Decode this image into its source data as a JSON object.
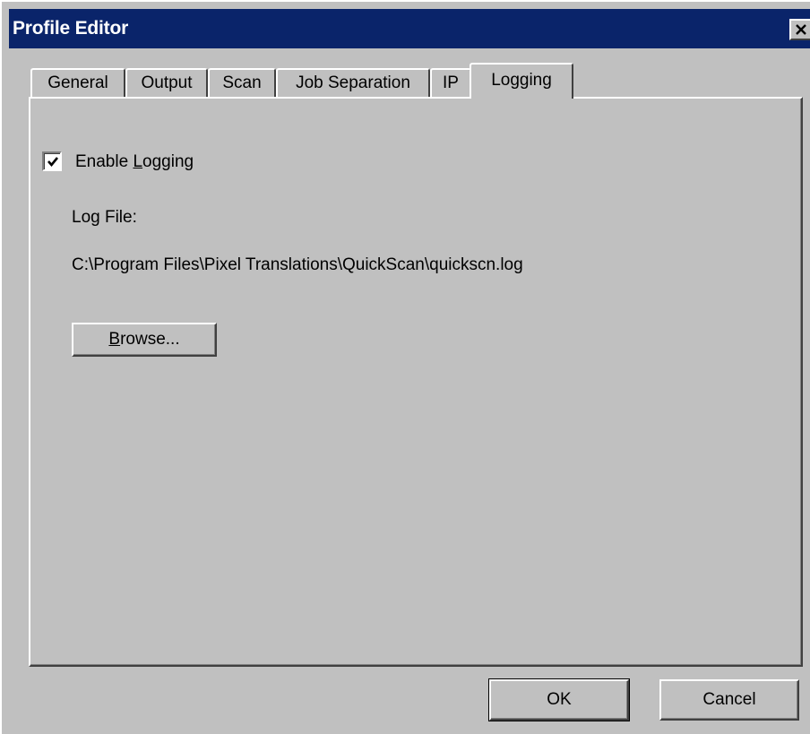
{
  "window": {
    "title": "Profile Editor"
  },
  "tabs": [
    {
      "label": "General",
      "active": false
    },
    {
      "label": "Output",
      "active": false
    },
    {
      "label": "Scan",
      "active": false
    },
    {
      "label": "Job Separation",
      "active": false
    },
    {
      "label": "IP",
      "active": false
    },
    {
      "label": "Logging",
      "active": true
    }
  ],
  "logging": {
    "enable_label_pre": "Enable ",
    "enable_label_mnemonic": "L",
    "enable_label_post": "ogging",
    "enabled": true,
    "log_file_label": "Log File:",
    "log_file_path": "C:\\Program Files\\Pixel Translations\\QuickScan\\quickscn.log",
    "browse_mnemonic": "B",
    "browse_rest": "rowse..."
  },
  "buttons": {
    "ok": "OK",
    "cancel": "Cancel"
  },
  "icons": {
    "close": "close-icon",
    "check": "check-icon"
  },
  "colors": {
    "titlebar": "#0a246a",
    "face": "#c0c0c0"
  }
}
